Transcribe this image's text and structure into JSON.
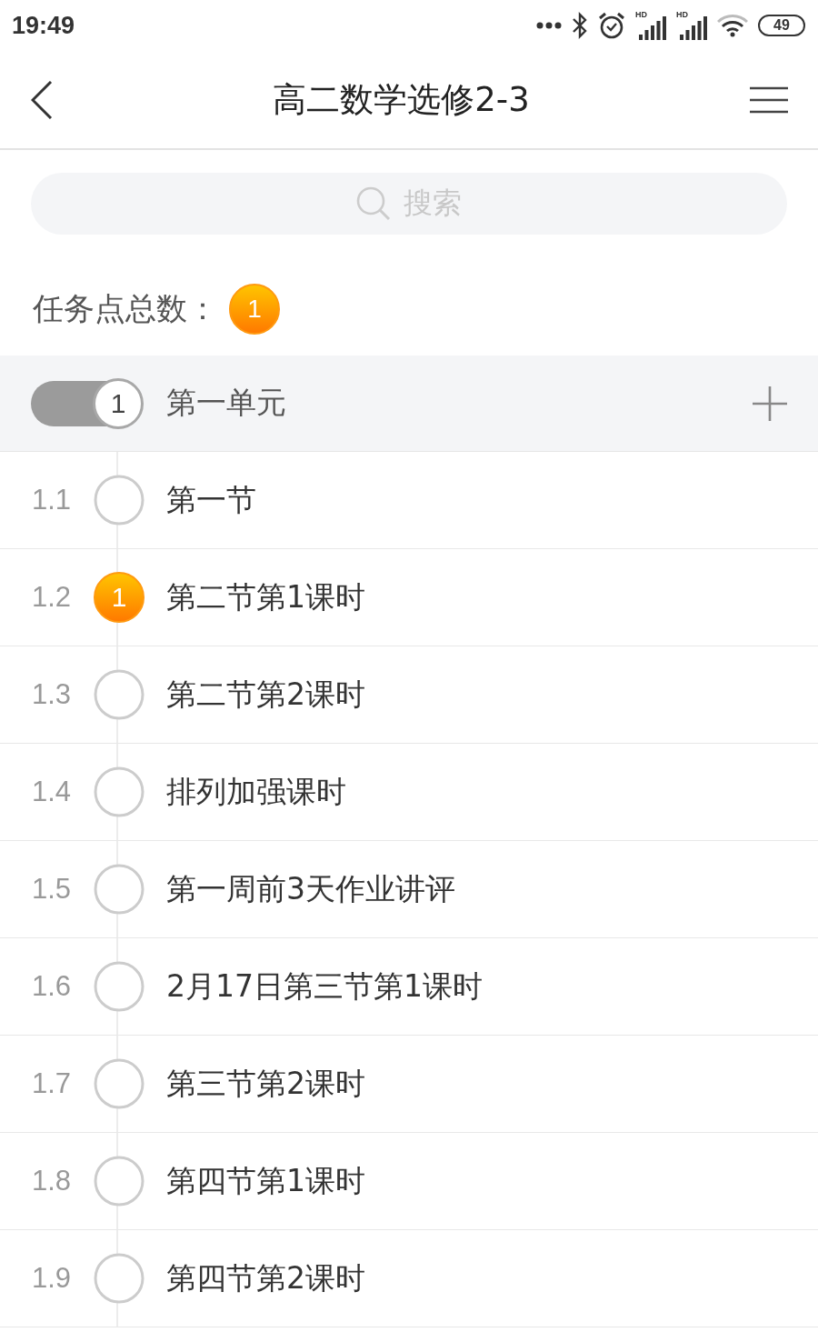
{
  "status_bar": {
    "time": "19:49",
    "signals": [
      {
        "label": "HD"
      },
      {
        "label": "HD"
      }
    ],
    "battery": "49"
  },
  "nav": {
    "title": "高二数学选修2-3"
  },
  "search": {
    "placeholder": "搜索"
  },
  "task_total": {
    "label": "任务点总数：",
    "count": "1"
  },
  "units": [
    {
      "number": "1",
      "title": "第一单元",
      "sections": [
        {
          "number": "1.1",
          "title": "第一节"
        },
        {
          "number": "1.2",
          "title": "第二节第1课时",
          "task_count": "1"
        },
        {
          "number": "1.3",
          "title": "第二节第2课时"
        },
        {
          "number": "1.4",
          "title": "排列加强课时"
        },
        {
          "number": "1.5",
          "title": "第一周前3天作业讲评"
        },
        {
          "number": "1.6",
          "title": "2月17日第三节第1课时"
        },
        {
          "number": "1.7",
          "title": "第三节第2课时"
        },
        {
          "number": "1.8",
          "title": "第四节第1课时"
        },
        {
          "number": "1.9",
          "title": "第四节第2课时"
        }
      ]
    }
  ]
}
